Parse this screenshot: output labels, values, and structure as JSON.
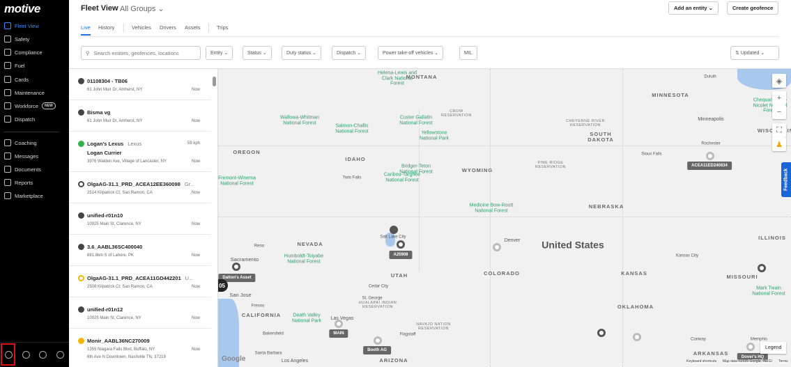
{
  "sidebar": {
    "logo": "motive",
    "items": [
      {
        "label": "Fleet View"
      },
      {
        "label": "Safety"
      },
      {
        "label": "Compliance"
      },
      {
        "label": "Fuel"
      },
      {
        "label": "Cards"
      },
      {
        "label": "Maintenance"
      },
      {
        "label": "Workforce",
        "badge": "NEW"
      },
      {
        "label": "Dispatch"
      },
      {
        "label": "Coaching"
      },
      {
        "label": "Messages"
      },
      {
        "label": "Documents"
      },
      {
        "label": "Reports"
      },
      {
        "label": "Marketplace"
      }
    ]
  },
  "header": {
    "title": "Fleet View",
    "group": "All Groups",
    "add_entity": "Add an entity",
    "create_geofence": "Create geofence",
    "tabs": [
      "Live",
      "History",
      "Vehicles",
      "Drivers",
      "Assets",
      "Trips"
    ],
    "search_placeholder": "Search entities, geofences, locations",
    "filters": [
      "Entity",
      "Status",
      "Duty status",
      "Dispatch",
      "Power take-off vehicles",
      "MIL"
    ],
    "sort": "Updated"
  },
  "list": [
    {
      "name": "01108304 - TB06",
      "address": "61 John Muir Dr, Amherst, NY",
      "time": "Now",
      "status": "gray"
    },
    {
      "name": "Bisma vg",
      "address": "61 John Muir Dr, Amherst, NY",
      "time": "Now",
      "status": "gray"
    },
    {
      "name": "Logan's Lexus",
      "extra": "Lexus",
      "speed": "59 kph",
      "driver": "Logan Currier",
      "address": "3976 Walden Ave, Village of Lancaster, NY",
      "time": "Now",
      "status": "green"
    },
    {
      "name": "OlgaAG-31.1_PRD_ACEA12EE360098",
      "extra": "Gr...",
      "address": "2514 Kilpatrick Ct, San Ramon, CA",
      "time": "Now",
      "status": "ring"
    },
    {
      "name": "unified-r01n10",
      "address": "10925 Main St, Clarence, NY",
      "time": "Now",
      "status": "gray"
    },
    {
      "name": "3.6_AABL36SC400040",
      "address": "881.8km S of Lahore, PK",
      "time": "Now",
      "status": "gray"
    },
    {
      "name": "OlgaAG-31.1_PRD_ACEA11GD442201",
      "extra": "U...",
      "address": "2508 Kilpatrick Ct, San Ramon, CA",
      "time": "Now",
      "status": "yellow"
    },
    {
      "name": "unified-r01n12",
      "address": "10925 Main St, Clarence, NY",
      "time": "Now",
      "status": "gray"
    },
    {
      "name": "Monir_AABL36NC270009",
      "address": "1355 Niagara Falls Blvd, Buffalo, NY",
      "address2": "6th Ave N Downtown, Nashville TN, 37219",
      "time": "Now",
      "status": "yellow"
    }
  ],
  "map": {
    "country": "United States",
    "labels": [
      "MONTANA",
      "MINNESOTA",
      "SOUTH DAKOTA",
      "OREGON",
      "IDAHO",
      "WYOMING",
      "NEBRASKA",
      "NEVADA",
      "UTAH",
      "COLORADO",
      "CALIFORNIA",
      "ARIZONA",
      "OKLAHOMA",
      "MISSOURI",
      "ILLINOIS",
      "ARKANSAS",
      "WISCONSIN",
      "KANSAS",
      "Helena-Lewis and Clark National Forest",
      "Wallowa-Whitman National Forest",
      "Salmon-Challis National Forest",
      "Custer Gallatin National Forest",
      "Yellowstone National Park",
      "Caribou-Targhee National Forest",
      "Bridger-Teton National Forest",
      "Medicine Bow-Routt National Forest",
      "Humboldt-Toiyabe National Forest",
      "Death Valley National Park",
      "Chequamegon-Nicolet National Forest",
      "Mark Twain National Forest",
      "Fremont-Winema National Forest",
      "Minneapolis",
      "Denver",
      "Salt Lake City",
      "Las Vegas",
      "Kansas City",
      "Sioux Falls",
      "Twin Falls",
      "Reno",
      "Fresno",
      "Bakersfield",
      "Conway",
      "Memphis",
      "Duluth",
      "Rochester",
      "Cedar City",
      "St. George",
      "Flagstaff",
      "San Jose",
      "Sacramento",
      "Los Angeles",
      "Santa Barbara",
      "CROW RESERVATION",
      "CHEYENNE RIVER RESERVATION",
      "PINE RIDGE RESERVATION",
      "NAVAJO NATION RESERVATION",
      "HUALAPAI INDIAN RESERVATION"
    ],
    "markers": [
      "ACEA11ED240834",
      "A25908",
      "Dalton's Asset",
      "MAIN",
      "Booth AG",
      "Dover's HQ"
    ],
    "cluster": "05",
    "feedback": "Feedback",
    "legend": "Legend",
    "google": "Google",
    "footer": [
      "Keyboard shortcuts",
      "Map data ©2025 Google, INEGI",
      "Terms"
    ]
  }
}
